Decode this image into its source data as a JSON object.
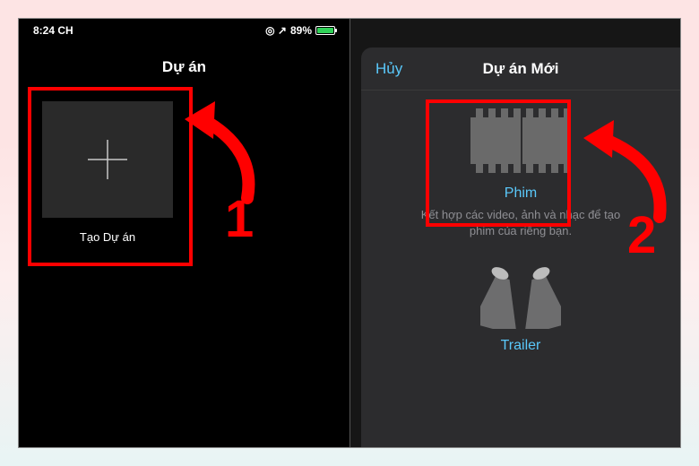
{
  "status": {
    "time": "8:24 CH",
    "battery_pct": "89%",
    "location_indicator": "◎ ↗"
  },
  "left": {
    "title": "Dự án",
    "create_label": "Tạo Dự án"
  },
  "right": {
    "cancel": "Hủy",
    "title": "Dự án Mới",
    "movie": {
      "label": "Phim",
      "desc": "Kết hợp các video, ảnh và nhạc để tạo phim của riêng bạn."
    },
    "trailer": {
      "label": "Trailer"
    }
  },
  "annotations": {
    "step1": "1",
    "step2": "2"
  }
}
